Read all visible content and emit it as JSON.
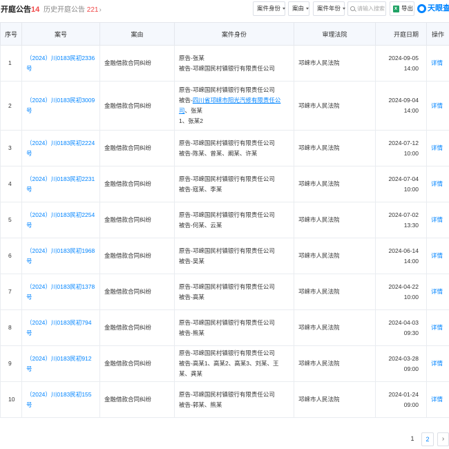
{
  "header": {
    "title": "开庭公告",
    "title_count": "14",
    "history_label": "历史开庭公告",
    "history_count": "221",
    "history_chevron": "›"
  },
  "filters": {
    "case_role": "案件身份",
    "case_cause": "案由",
    "case_year": "案件年份",
    "search_placeholder": "请输入搜索"
  },
  "export_label": "导出",
  "brand": "天眼查",
  "table": {
    "columns": [
      "序号",
      "案号",
      "案由",
      "案件身份",
      "审理法院",
      "开庭日期",
      "操作"
    ],
    "rows": [
      {
        "no": "1",
        "case_no": "（2024）川0183民初2336号",
        "cause": "金融借款合同纠纷",
        "party1": "原告-张某",
        "party2": "被告-邛崃国民村镇银行有限责任公司",
        "court": "邛崃市人民法院",
        "date": "2024-09-05 14:00",
        "op": "详情"
      },
      {
        "no": "2",
        "case_no": "（2024）川0183民初3009号",
        "cause": "金融借款合同纠纷",
        "party1": "原告-邛崃国民村镇银行有限责任公司",
        "party2_prefix": "被告-",
        "party2_link": "四川省邛崃市阳光汽修有限责任公司",
        "party2_suffix": "、张某",
        "party3": "1、张某2",
        "court": "邛崃市人民法院",
        "date": "2024-09-04 14:00",
        "op": "详情"
      },
      {
        "no": "3",
        "case_no": "（2024）川0183民初2224号",
        "cause": "金融借款合同纠纷",
        "party1": "原告-邛崃国民村镇银行有限责任公司",
        "party2": "被告-陈某、曾某、阚某、许某",
        "court": "邛崃市人民法院",
        "date": "2024-07-12 10:00",
        "op": "详情"
      },
      {
        "no": "4",
        "case_no": "（2024）川0183民初2231号",
        "cause": "金融借款合同纠纷",
        "party1": "原告-邛崃国民村镇银行有限责任公司",
        "party2": "被告-寇某、李某",
        "court": "邛崃市人民法院",
        "date": "2024-07-04 10:00",
        "op": "详情"
      },
      {
        "no": "5",
        "case_no": "（2024）川0183民初2254号",
        "cause": "金融借款合同纠纷",
        "party1": "原告-邛崃国民村镇银行有限责任公司",
        "party2": "被告-何某、云某",
        "court": "邛崃市人民法院",
        "date": "2024-07-02 13:30",
        "op": "详情"
      },
      {
        "no": "6",
        "case_no": "（2024）川0183民初1968号",
        "cause": "金融借款合同纠纷",
        "party1": "原告-邛崃国民村镇银行有限责任公司",
        "party2": "被告-吴某",
        "court": "邛崃市人民法院",
        "date": "2024-06-14 14:00",
        "op": "详情"
      },
      {
        "no": "7",
        "case_no": "（2024）川0183民初1378号",
        "cause": "金融借款合同纠纷",
        "party1": "原告-邛崃国民村镇银行有限责任公司",
        "party2": "被告-高某",
        "court": "邛崃市人民法院",
        "date": "2024-04-22 10:00",
        "op": "详情"
      },
      {
        "no": "8",
        "case_no": "（2024）川0183民初794号",
        "cause": "金融借款合同纠纷",
        "party1": "原告-邛崃国民村镇银行有限责任公司",
        "party2": "被告-熊某",
        "court": "邛崃市人民法院",
        "date": "2024-04-03 09:30",
        "op": "详情"
      },
      {
        "no": "9",
        "case_no": "（2024）川0183民初912号",
        "cause": "金融借款合同纠纷",
        "party1": "原告-邛崃国民村镇银行有限责任公司",
        "party2": "被告-高某1、高某2、高某3、刘某、王某、龚某",
        "court": "邛崃市人民法院",
        "date": "2024-03-28 09:00",
        "op": "详情"
      },
      {
        "no": "10",
        "case_no": "（2024）川0183民初155号",
        "cause": "金融借款合同纠纷",
        "party1": "原告-邛崃国民村镇银行有限责任公司",
        "party2": "被告-郭某、熊某",
        "court": "邛崃市人民法院",
        "date": "2024-01-24 09:00",
        "op": "详情"
      }
    ]
  },
  "pagination": {
    "page1": "1",
    "page2": "2",
    "next": "›"
  }
}
